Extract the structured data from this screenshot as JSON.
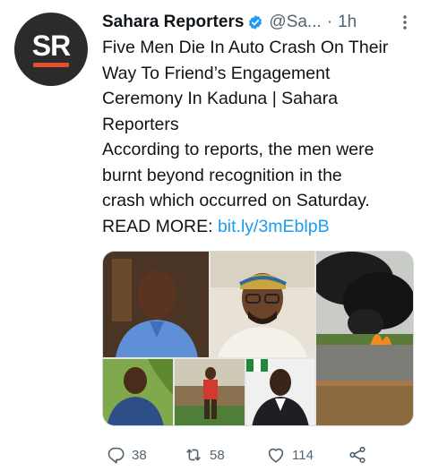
{
  "tweet": {
    "author_name": "Sahara Reporters",
    "handle": "@Sa...",
    "separator": "·",
    "time": "1h",
    "avatar_text": "SR",
    "lines": [
      "Five Men Die In Auto Crash On Their",
      "Way To Friend’s Engagement",
      "Ceremony In Kaduna | Sahara",
      "Reporters",
      "According to reports, the men were",
      "burnt beyond recognition in the",
      "crash which occurred on Saturday."
    ],
    "read_more_label": "READ MORE:",
    "link_text": "bit.ly/3mEblpB"
  },
  "actions": {
    "replies": "38",
    "retweets": "58",
    "likes": "114"
  },
  "colors": {
    "link": "#1d9bf0",
    "secondary_text": "#536471",
    "verified": "#1d9bf0",
    "avatar_bg": "#2b2b2b",
    "avatar_bar": "#e4502a"
  },
  "icons": {
    "verified": "verified-badge-icon",
    "more": "more-options-icon",
    "reply": "reply-icon",
    "retweet": "retweet-icon",
    "like": "heart-icon",
    "share": "share-icon"
  }
}
